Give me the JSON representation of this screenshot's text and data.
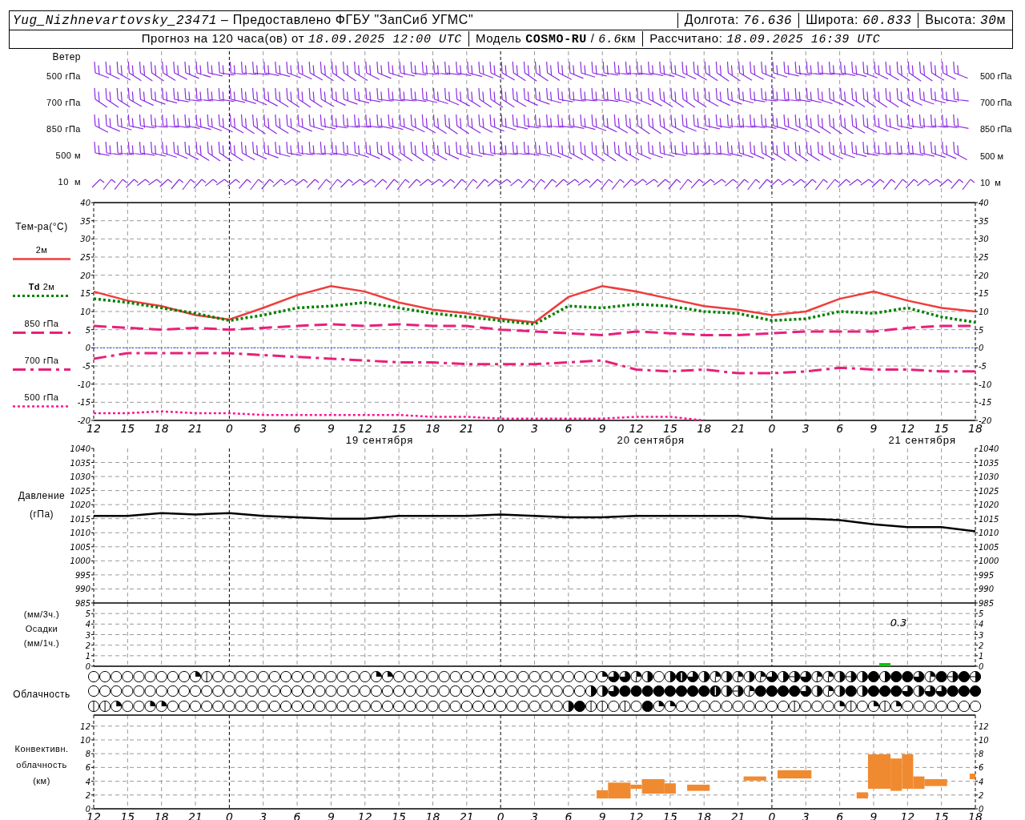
{
  "header": {
    "lines": [
      {
        "segments": [
          [
            {
              "kind": "italic",
              "text": "Yug_Nizhnevartovsky_23471"
            },
            {
              "kind": "plain",
              "text": " – Предоставлено ФГБУ \"ЗапСиб УГМС\""
            }
          ],
          [
            {
              "kind": "plain",
              "text": "Долгота: "
            },
            {
              "kind": "italic",
              "text": "76.636"
            }
          ],
          [
            {
              "kind": "plain",
              "text": "Широта: "
            },
            {
              "kind": "italic",
              "text": "60.833"
            }
          ],
          [
            {
              "kind": "plain",
              "text": "Высота: "
            },
            {
              "kind": "italic",
              "text": "30"
            },
            {
              "kind": "plain",
              "text": "м"
            }
          ]
        ]
      },
      {
        "segments": [
          [
            {
              "kind": "plain",
              "text": "Прогноз на 120 часа(ов) от "
            },
            {
              "kind": "italic",
              "text": "18.09.2025 12:00 UTC"
            }
          ],
          [
            {
              "kind": "plain",
              "text": "Модель "
            },
            {
              "kind": "bold",
              "text": "COSMO-RU"
            },
            {
              "kind": "plain",
              "text": " / "
            },
            {
              "kind": "italic",
              "text": "6.6"
            },
            {
              "kind": "plain",
              "text": "км"
            }
          ],
          [
            {
              "kind": "plain",
              "text": "Рассчитано: "
            },
            {
              "kind": "italic",
              "text": "18.09.2025 16:39 UTC"
            }
          ]
        ]
      }
    ]
  },
  "wind": {
    "title": "Ветер",
    "levels_left": [
      "500 гПа",
      "700 гПа",
      "850 гПа",
      "500 м",
      "10  м"
    ],
    "levels_right": [
      "500 гПа",
      "700 гПа",
      "850 гПа",
      "500 м",
      "10  м"
    ]
  },
  "temperature": {
    "title": "Тем-ра(°C)",
    "right_axis": [
      "40",
      "35",
      "30",
      "25",
      "20",
      "15",
      "10",
      "5",
      "0",
      "-5",
      "-10",
      "-15",
      "-20"
    ],
    "chart_data": {
      "type": "line",
      "categories": [
        "12",
        "15",
        "18",
        "21",
        "0",
        "3",
        "6",
        "9",
        "12",
        "15",
        "18",
        "21",
        "0",
        "3",
        "6",
        "9",
        "12",
        "15",
        "18",
        "21",
        "0",
        "3",
        "6",
        "9",
        "12",
        "15",
        "18"
      ],
      "ylim": [
        -20,
        40
      ],
      "yticks": [
        -20,
        -15,
        -10,
        -5,
        0,
        5,
        10,
        15,
        20,
        25,
        30,
        35,
        40
      ],
      "grid": true,
      "ref_lines": [
        {
          "axis": "y",
          "value": 0,
          "color": "#2040ff"
        }
      ],
      "series": [
        {
          "name": "2м",
          "color": "#f03c3c",
          "line_style": "solid",
          "values": [
            15.5,
            13,
            11.5,
            9,
            7.8,
            11,
            14.5,
            17,
            15.5,
            12.5,
            10.5,
            9.5,
            8,
            7,
            14,
            17,
            15.5,
            13.5,
            11.5,
            10.5,
            9,
            10,
            13.5,
            15.5,
            13,
            11,
            10
          ]
        },
        {
          "name": "**Td** 2м",
          "color": "#008000",
          "line_style": "dotted",
          "values": [
            13.5,
            12.5,
            11,
            9.5,
            7.5,
            9,
            11,
            11.5,
            12.5,
            11,
            9.5,
            8.5,
            7.5,
            6.5,
            11.5,
            11,
            12,
            11.5,
            10,
            9.5,
            7.5,
            8,
            10,
            9.5,
            11,
            8.5,
            7
          ]
        },
        {
          "name": "850 гПа",
          "color": "#e8207a",
          "line_style": "dashed",
          "values": [
            6,
            5.5,
            5,
            5.5,
            5,
            5.5,
            6,
            6.5,
            6,
            6.5,
            6,
            6,
            5,
            4.5,
            4,
            3.5,
            4.5,
            4,
            3.5,
            3.5,
            4,
            4.5,
            4.5,
            4.5,
            5.5,
            6,
            6
          ]
        },
        {
          "name": "700 гПа",
          "color": "#e8207a",
          "line_style": "dashdot",
          "values": [
            -3,
            -1.5,
            -1.5,
            -1.5,
            -1.5,
            -2,
            -2.5,
            -3,
            -3.5,
            -4,
            -4,
            -4.5,
            -4.5,
            -4.5,
            -4,
            -3.5,
            -6,
            -6.5,
            -6,
            -7,
            -7,
            -6.5,
            -5.5,
            -6,
            -6,
            -6.5,
            -6.5
          ]
        },
        {
          "name": "500 гПа",
          "color": "#ff1493",
          "line_style": "dotted",
          "values": [
            -18,
            -18,
            -17.5,
            -18,
            -18,
            -18.5,
            -18.5,
            -18.5,
            -18.5,
            -18.5,
            -19,
            -19,
            -19.5,
            -19.5,
            -19.5,
            -19.5,
            -19,
            -19,
            -20,
            null,
            null,
            null,
            null,
            null,
            null,
            null,
            null
          ]
        }
      ],
      "annotations": [
        "19 сентября",
        "20 сентября",
        "21 сентября"
      ]
    }
  },
  "pressure": {
    "labels": [
      "Давление",
      "(гПа)"
    ],
    "right_axis": [
      "1040",
      "1035",
      "1030",
      "1025",
      "1020",
      "1015",
      "1010",
      "1005",
      "1000",
      "995",
      "990",
      "985"
    ],
    "chart_data": {
      "type": "line",
      "categories": [
        null,
        null,
        null,
        null,
        null,
        null,
        null,
        null,
        null,
        null,
        null,
        null,
        null,
        null,
        null,
        null,
        null,
        null,
        null,
        null,
        null,
        null,
        null,
        null,
        null,
        null,
        null
      ],
      "ylim": [
        985,
        1040
      ],
      "yticks": [
        985,
        990,
        995,
        1000,
        1005,
        1010,
        1015,
        1020,
        1025,
        1030,
        1035,
        1040
      ],
      "grid": true,
      "series": [
        {
          "color": "#000000",
          "line_style": "solid",
          "values": [
            1016,
            1016,
            1017,
            1016.5,
            1017,
            1016,
            1015.5,
            1015,
            1015,
            1016,
            1016,
            1016,
            1016.5,
            1016,
            1015.5,
            1015.5,
            1016,
            1016,
            1016,
            1016,
            1015,
            1015,
            1014.5,
            1013,
            1012,
            1012,
            1010.5
          ]
        }
      ]
    }
  },
  "precipitation": {
    "labels": [
      "(мм/3ч.)",
      "Осадки",
      "(мм/1ч.)"
    ],
    "right_axis": [
      "5",
      "4",
      "3",
      "2",
      "1",
      "0"
    ],
    "chart_data": {
      "type": "bar",
      "categories": [
        null,
        null,
        null,
        null,
        null,
        null,
        null,
        null,
        null,
        null,
        null,
        null,
        null,
        null,
        null,
        null,
        null,
        null,
        null,
        null,
        null,
        null,
        null,
        null,
        null,
        null,
        null,
        null,
        null,
        null,
        null,
        null,
        null,
        null,
        null,
        null,
        null,
        null,
        null,
        null,
        null,
        null,
        null,
        null,
        null,
        null,
        null,
        null,
        null,
        null,
        null,
        null,
        null,
        null,
        null,
        null,
        null,
        null,
        null,
        null,
        null,
        null,
        null,
        null,
        null,
        null,
        null,
        null,
        null,
        null,
        null,
        null,
        null,
        null,
        null,
        null,
        null,
        null,
        null
      ],
      "ylim": [
        0,
        6
      ],
      "yticks": [
        0,
        1,
        2,
        3,
        4,
        5
      ],
      "grid": true,
      "series": [
        {
          "color": "#00cc00",
          "values": [
            0,
            0,
            0,
            0,
            0,
            0,
            0,
            0,
            0,
            0,
            0,
            0,
            0,
            0,
            0,
            0,
            0,
            0,
            0,
            0,
            0,
            0,
            0,
            0,
            0,
            0,
            0,
            0,
            0,
            0,
            0,
            0,
            0,
            0,
            0,
            0,
            0,
            0,
            0,
            0,
            0,
            0,
            0,
            0,
            0,
            0,
            0,
            0,
            0,
            0,
            0,
            0,
            0,
            0,
            0,
            0,
            0,
            0,
            0,
            0,
            0,
            0,
            0,
            0,
            0,
            0,
            0,
            0,
            0,
            0,
            0.3,
            0,
            0,
            0,
            0,
            0,
            0,
            0,
            0
          ]
        }
      ],
      "annotations": [
        "0.3"
      ]
    }
  },
  "cloudiness": {
    "title": "Облачность",
    "rows": [
      {
        "cells": [
          {
            "kind": "okta0"
          },
          {
            "kind": "okta0"
          },
          {
            "kind": "okta0"
          },
          {
            "kind": "okta0"
          },
          {
            "kind": "okta0"
          },
          {
            "kind": "okta0"
          },
          {
            "kind": "okta0"
          },
          {
            "kind": "okta0"
          },
          {
            "kind": "okta0"
          },
          {
            "kind": "okta2"
          },
          {
            "kind": "okta1"
          },
          {
            "kind": "okta0"
          },
          {
            "kind": "okta0"
          },
          {
            "kind": "okta0"
          },
          {
            "kind": "okta0"
          },
          {
            "kind": "okta0"
          },
          {
            "kind": "okta0"
          },
          {
            "kind": "okta0"
          },
          {
            "kind": "okta0"
          },
          {
            "kind": "okta0"
          },
          {
            "kind": "okta0"
          },
          {
            "kind": "okta0"
          },
          {
            "kind": "okta0"
          },
          {
            "kind": "okta0"
          },
          {
            "kind": "okta0"
          },
          {
            "kind": "okta2"
          },
          {
            "kind": "okta2"
          },
          {
            "kind": "okta0"
          },
          {
            "kind": "okta0"
          },
          {
            "kind": "okta0"
          },
          {
            "kind": "okta0"
          },
          {
            "kind": "okta0"
          },
          {
            "kind": "okta0"
          },
          {
            "kind": "okta0"
          },
          {
            "kind": "okta0"
          },
          {
            "kind": "okta0"
          },
          {
            "kind": "okta0"
          },
          {
            "kind": "okta0"
          },
          {
            "kind": "okta0"
          },
          {
            "kind": "okta0"
          },
          {
            "kind": "okta0"
          },
          {
            "kind": "okta0"
          },
          {
            "kind": "okta0"
          },
          {
            "kind": "okta0"
          },
          {
            "kind": "okta0"
          },
          {
            "kind": "okta2"
          },
          {
            "kind": "okta6"
          },
          {
            "kind": "okta6"
          },
          {
            "kind": "okta3"
          },
          {
            "kind": "okta4"
          },
          {
            "kind": "okta0"
          },
          {
            "kind": "okta4"
          },
          {
            "kind": "okta7"
          },
          {
            "kind": "okta6"
          },
          {
            "kind": "okta4"
          },
          {
            "kind": "okta3"
          },
          {
            "kind": "okta4"
          },
          {
            "kind": "okta3"
          },
          {
            "kind": "okta4"
          },
          {
            "kind": "okta3"
          },
          {
            "kind": "okta6"
          },
          {
            "kind": "okta4"
          },
          {
            "kind": "okta5"
          },
          {
            "kind": "okta6"
          },
          {
            "kind": "okta3"
          },
          {
            "kind": "okta3"
          },
          {
            "kind": "okta4"
          },
          {
            "kind": "okta5"
          },
          {
            "kind": "okta4"
          },
          {
            "kind": "okta8"
          },
          {
            "kind": "okta4"
          },
          {
            "kind": "okta8"
          },
          {
            "kind": "okta8"
          },
          {
            "kind": "okta6"
          },
          {
            "kind": "okta3"
          },
          {
            "kind": "okta8"
          },
          {
            "kind": "okta5"
          },
          {
            "kind": "okta8"
          },
          {
            "kind": "okta5"
          }
        ]
      },
      {
        "cells": [
          {
            "kind": "okta0"
          },
          {
            "kind": "okta0"
          },
          {
            "kind": "okta0"
          },
          {
            "kind": "okta0"
          },
          {
            "kind": "okta0"
          },
          {
            "kind": "okta0"
          },
          {
            "kind": "okta0"
          },
          {
            "kind": "okta0"
          },
          {
            "kind": "okta0"
          },
          {
            "kind": "okta0"
          },
          {
            "kind": "okta0"
          },
          {
            "kind": "okta0"
          },
          {
            "kind": "okta0"
          },
          {
            "kind": "okta0"
          },
          {
            "kind": "okta0"
          },
          {
            "kind": "okta0"
          },
          {
            "kind": "okta0"
          },
          {
            "kind": "okta0"
          },
          {
            "kind": "okta0"
          },
          {
            "kind": "okta0"
          },
          {
            "kind": "okta0"
          },
          {
            "kind": "okta0"
          },
          {
            "kind": "okta0"
          },
          {
            "kind": "okta0"
          },
          {
            "kind": "okta0"
          },
          {
            "kind": "okta0"
          },
          {
            "kind": "okta0"
          },
          {
            "kind": "okta0"
          },
          {
            "kind": "okta0"
          },
          {
            "kind": "okta0"
          },
          {
            "kind": "okta0"
          },
          {
            "kind": "okta0"
          },
          {
            "kind": "okta0"
          },
          {
            "kind": "okta0"
          },
          {
            "kind": "okta0"
          },
          {
            "kind": "okta0"
          },
          {
            "kind": "okta0"
          },
          {
            "kind": "okta0"
          },
          {
            "kind": "okta0"
          },
          {
            "kind": "okta0"
          },
          {
            "kind": "okta0"
          },
          {
            "kind": "okta0"
          },
          {
            "kind": "okta0"
          },
          {
            "kind": "okta0"
          },
          {
            "kind": "okta4"
          },
          {
            "kind": "okta4"
          },
          {
            "kind": "okta6"
          },
          {
            "kind": "okta8"
          },
          {
            "kind": "okta8"
          },
          {
            "kind": "okta8"
          },
          {
            "kind": "okta8"
          },
          {
            "kind": "okta8"
          },
          {
            "kind": "okta8"
          },
          {
            "kind": "okta8"
          },
          {
            "kind": "okta8"
          },
          {
            "kind": "okta7"
          },
          {
            "kind": "okta4"
          },
          {
            "kind": "okta5"
          },
          {
            "kind": "okta3"
          },
          {
            "kind": "okta8"
          },
          {
            "kind": "okta8"
          },
          {
            "kind": "okta8"
          },
          {
            "kind": "okta8"
          },
          {
            "kind": "okta6"
          },
          {
            "kind": "okta4"
          },
          {
            "kind": "okta3"
          },
          {
            "kind": "okta4"
          },
          {
            "kind": "okta8"
          },
          {
            "kind": "okta4"
          },
          {
            "kind": "okta8"
          },
          {
            "kind": "okta8"
          },
          {
            "kind": "okta8"
          },
          {
            "kind": "okta6"
          },
          {
            "kind": "okta4"
          },
          {
            "kind": "okta6"
          },
          {
            "kind": "okta6"
          },
          {
            "kind": "okta8"
          },
          {
            "kind": "okta8"
          },
          {
            "kind": "okta8"
          }
        ]
      },
      {
        "cells": [
          {
            "kind": "okta1"
          },
          {
            "kind": "okta1"
          },
          {
            "kind": "okta2"
          },
          {
            "kind": "okta0"
          },
          {
            "kind": "okta0"
          },
          {
            "kind": "okta2"
          },
          {
            "kind": "okta2"
          },
          {
            "kind": "okta0"
          },
          {
            "kind": "okta0"
          },
          {
            "kind": "okta0"
          },
          {
            "kind": "okta0"
          },
          {
            "kind": "okta0"
          },
          {
            "kind": "okta0"
          },
          {
            "kind": "okta0"
          },
          {
            "kind": "okta0"
          },
          {
            "kind": "okta0"
          },
          {
            "kind": "okta0"
          },
          {
            "kind": "okta0"
          },
          {
            "kind": "okta0"
          },
          {
            "kind": "okta0"
          },
          {
            "kind": "okta0"
          },
          {
            "kind": "okta0"
          },
          {
            "kind": "okta0"
          },
          {
            "kind": "okta0"
          },
          {
            "kind": "okta0"
          },
          {
            "kind": "okta0"
          },
          {
            "kind": "okta0"
          },
          {
            "kind": "okta0"
          },
          {
            "kind": "okta0"
          },
          {
            "kind": "okta0"
          },
          {
            "kind": "okta0"
          },
          {
            "kind": "okta0"
          },
          {
            "kind": "okta0"
          },
          {
            "kind": "okta0"
          },
          {
            "kind": "okta0"
          },
          {
            "kind": "okta0"
          },
          {
            "kind": "okta0"
          },
          {
            "kind": "okta0"
          },
          {
            "kind": "okta0"
          },
          {
            "kind": "okta0"
          },
          {
            "kind": "okta0"
          },
          {
            "kind": "okta0"
          },
          {
            "kind": "okta4"
          },
          {
            "kind": "okta8"
          },
          {
            "kind": "okta1"
          },
          {
            "kind": "okta1"
          },
          {
            "kind": "okta0"
          },
          {
            "kind": "okta1"
          },
          {
            "kind": "okta0"
          },
          {
            "kind": "okta8"
          },
          {
            "kind": "okta2"
          },
          {
            "kind": "okta2"
          },
          {
            "kind": "okta0"
          },
          {
            "kind": "okta0"
          },
          {
            "kind": "okta0"
          },
          {
            "kind": "okta0"
          },
          {
            "kind": "okta0"
          },
          {
            "kind": "okta0"
          },
          {
            "kind": "okta0"
          },
          {
            "kind": "okta0"
          },
          {
            "kind": "okta0"
          },
          {
            "kind": "okta0"
          },
          {
            "kind": "okta1"
          },
          {
            "kind": "okta0"
          },
          {
            "kind": "okta0"
          },
          {
            "kind": "okta0"
          },
          {
            "kind": "okta2"
          },
          {
            "kind": "okta1"
          },
          {
            "kind": "okta0"
          },
          {
            "kind": "okta2"
          },
          {
            "kind": "okta1"
          },
          {
            "kind": "okta2"
          },
          {
            "kind": "okta0"
          },
          {
            "kind": "okta0"
          },
          {
            "kind": "okta0"
          },
          {
            "kind": "okta0"
          },
          {
            "kind": "okta0"
          },
          {
            "kind": "okta0"
          },
          {
            "kind": "okta0"
          }
        ]
      }
    ]
  },
  "convective": {
    "labels": [
      "Конвективн.",
      "облачность",
      "(км)"
    ],
    "left_axis": [
      "12",
      "10",
      "8",
      "6",
      "4",
      "2",
      "0"
    ],
    "right_axis": [
      "12",
      "10",
      "8",
      "6",
      "4",
      "2",
      "0"
    ],
    "time_axis": [
      "12",
      "15",
      "18",
      "21",
      "0",
      "3",
      "6",
      "9",
      "12",
      "15",
      "18",
      "21",
      "0",
      "3",
      "6",
      "9",
      "12",
      "15",
      "18",
      "21",
      "0",
      "3",
      "6",
      "9",
      "12",
      "15",
      "18"
    ]
  }
}
